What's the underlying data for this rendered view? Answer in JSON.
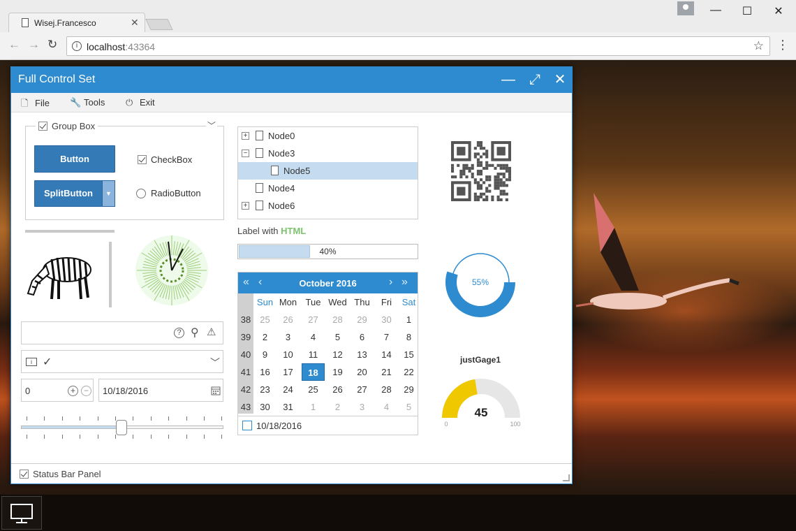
{
  "browser": {
    "tab_title": "Wisej.Francesco",
    "url_host": "localhost",
    "url_port": ":43364"
  },
  "window": {
    "title": "Full Control Set",
    "menu": [
      {
        "label": "File",
        "icon": "file-icon"
      },
      {
        "label": "Tools",
        "icon": "wrench-icon"
      },
      {
        "label": "Exit",
        "icon": "power-icon"
      }
    ]
  },
  "groupbox": {
    "title": "Group Box",
    "checked": true,
    "button_label": "Button",
    "splitbutton_label": "SplitButton",
    "checkbox_label": "CheckBox",
    "checkbox_checked": true,
    "radio_label": "RadioButton"
  },
  "numeric": {
    "value": "0"
  },
  "datepicker": {
    "value": "10/18/2016"
  },
  "slider": {
    "value": 0.5
  },
  "tree": {
    "nodes": [
      {
        "label": "Node0",
        "expander": "+",
        "level": 0,
        "selected": false
      },
      {
        "label": "Node3",
        "expander": "−",
        "level": 0,
        "selected": false
      },
      {
        "label": "Node5",
        "expander": "",
        "level": 1,
        "selected": true
      },
      {
        "label": "Node4",
        "expander": "",
        "level": 0,
        "selected": false
      },
      {
        "label": "Node6",
        "expander": "+",
        "level": 0,
        "selected": false
      }
    ]
  },
  "label_html": {
    "prefix": "Label with ",
    "highlight": "HTML"
  },
  "progress": {
    "value": 0.4,
    "text": "40%"
  },
  "calendar": {
    "month_label": "October 2016",
    "weekdays": [
      "Sun",
      "Mon",
      "Tue",
      "Wed",
      "Thu",
      "Fri",
      "Sat"
    ],
    "weeks": [
      {
        "wk": "38",
        "days": [
          "25",
          "26",
          "27",
          "28",
          "29",
          "30",
          "1"
        ]
      },
      {
        "wk": "39",
        "days": [
          "2",
          "3",
          "4",
          "5",
          "6",
          "7",
          "8"
        ]
      },
      {
        "wk": "40",
        "days": [
          "9",
          "10",
          "11",
          "12",
          "13",
          "14",
          "15"
        ]
      },
      {
        "wk": "41",
        "days": [
          "16",
          "17",
          "18",
          "19",
          "20",
          "21",
          "22"
        ]
      },
      {
        "wk": "42",
        "days": [
          "23",
          "24",
          "25",
          "26",
          "27",
          "28",
          "29"
        ]
      },
      {
        "wk": "43",
        "days": [
          "30",
          "31",
          "1",
          "2",
          "3",
          "4",
          "5"
        ]
      }
    ],
    "selected_day": "18",
    "footer_date": "10/18/2016"
  },
  "donut": {
    "value": 0.55,
    "text": "55%"
  },
  "gauge": {
    "title": "justGage1",
    "value": "45",
    "min": "0",
    "max": "100",
    "fraction": 0.45
  },
  "statusbar": {
    "panel_label": "Status Bar Panel"
  },
  "colors": {
    "accent": "#2e8bcf",
    "button": "#337ab7",
    "gauge": "#f0c800",
    "html_label": "#7dc36e"
  }
}
